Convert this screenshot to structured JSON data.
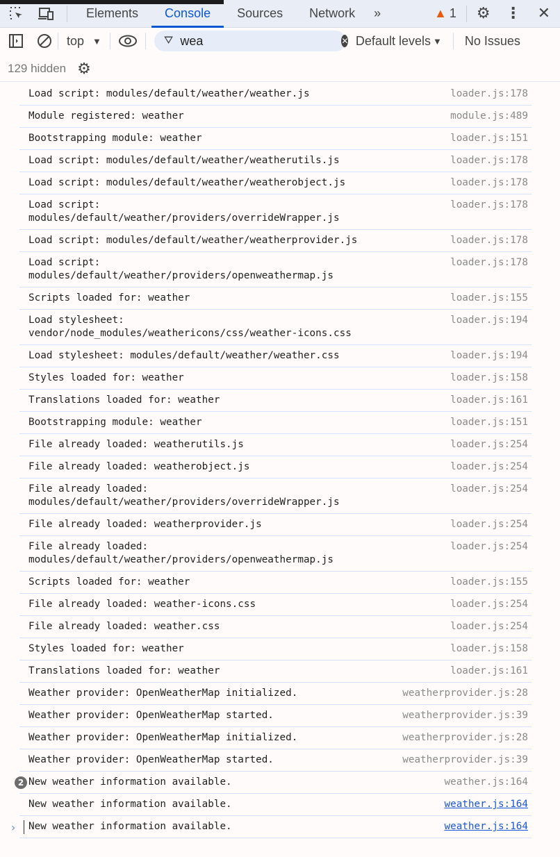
{
  "tabs": {
    "items": [
      "Elements",
      "Console",
      "Sources",
      "Network"
    ],
    "more": "»",
    "warning_count": "1"
  },
  "toolbar": {
    "context": "top",
    "filter_value": "wea",
    "levels": "Default levels",
    "issues": "No Issues"
  },
  "hidden": "129 hidden",
  "logs": [
    {
      "msg": "Load script: modules/default/weather/weather.js",
      "src": "loader.js:178"
    },
    {
      "msg": "Module registered: weather",
      "src": "module.js:489"
    },
    {
      "msg": "Bootstrapping module: weather",
      "src": "loader.js:151"
    },
    {
      "msg": "Load script: modules/default/weather/weatherutils.js",
      "src": "loader.js:178"
    },
    {
      "msg": "Load script: modules/default/weather/weatherobject.js",
      "src": "loader.js:178"
    },
    {
      "msg": "Load script:\nmodules/default/weather/providers/overrideWrapper.js",
      "src": "loader.js:178"
    },
    {
      "msg": "Load script: modules/default/weather/weatherprovider.js",
      "src": "loader.js:178"
    },
    {
      "msg": "Load script:\nmodules/default/weather/providers/openweathermap.js",
      "src": "loader.js:178"
    },
    {
      "msg": "Scripts loaded for: weather",
      "src": "loader.js:155"
    },
    {
      "msg": "Load stylesheet:\nvendor/node_modules/weathericons/css/weather-icons.css",
      "src": "loader.js:194"
    },
    {
      "msg": "Load stylesheet: modules/default/weather/weather.css",
      "src": "loader.js:194"
    },
    {
      "msg": "Styles loaded for: weather",
      "src": "loader.js:158"
    },
    {
      "msg": "Translations loaded for: weather",
      "src": "loader.js:161"
    },
    {
      "msg": "Bootstrapping module: weather",
      "src": "loader.js:151"
    },
    {
      "msg": "File already loaded: weatherutils.js",
      "src": "loader.js:254"
    },
    {
      "msg": "File already loaded: weatherobject.js",
      "src": "loader.js:254"
    },
    {
      "msg": "File already loaded:\nmodules/default/weather/providers/overrideWrapper.js",
      "src": "loader.js:254"
    },
    {
      "msg": "File already loaded: weatherprovider.js",
      "src": "loader.js:254"
    },
    {
      "msg": "File already loaded:\nmodules/default/weather/providers/openweathermap.js",
      "src": "loader.js:254"
    },
    {
      "msg": "Scripts loaded for: weather",
      "src": "loader.js:155"
    },
    {
      "msg": "File already loaded: weather-icons.css",
      "src": "loader.js:254"
    },
    {
      "msg": "File already loaded: weather.css",
      "src": "loader.js:254"
    },
    {
      "msg": "Styles loaded for: weather",
      "src": "loader.js:158"
    },
    {
      "msg": "Translations loaded for: weather",
      "src": "loader.js:161"
    },
    {
      "msg": "Weather provider: OpenWeatherMap initialized.",
      "src": "weatherprovider.js:28"
    },
    {
      "msg": "Weather provider: OpenWeatherMap started.",
      "src": "weatherprovider.js:39"
    },
    {
      "msg": "Weather provider: OpenWeatherMap initialized.",
      "src": "weatherprovider.js:28"
    },
    {
      "msg": "Weather provider: OpenWeatherMap started.",
      "src": "weatherprovider.js:39"
    },
    {
      "msg": "New weather information available.",
      "src": "weather.js:164",
      "count": "2"
    },
    {
      "msg": "New weather information available.",
      "src": "weather.js:164",
      "link": true
    },
    {
      "msg": "New weather information available.",
      "src": "weather.js:164",
      "link": true
    }
  ]
}
